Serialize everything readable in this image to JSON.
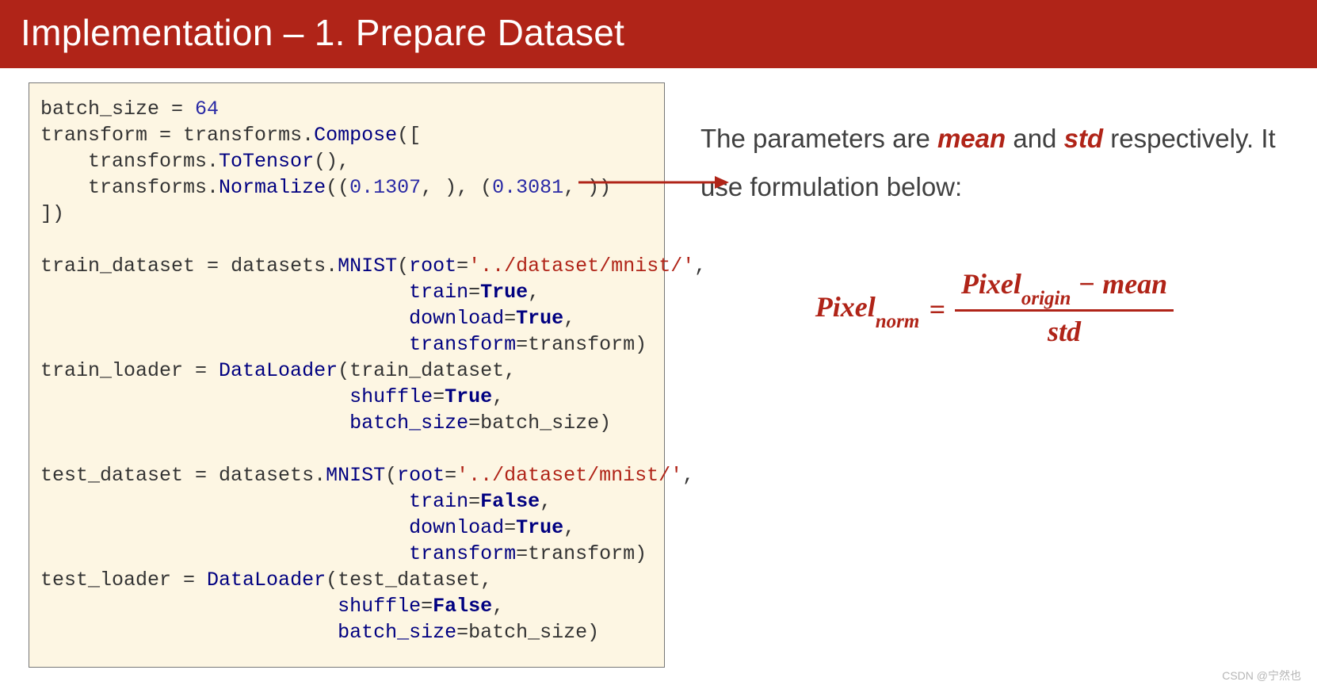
{
  "header": {
    "title": "Implementation – 1. Prepare Dataset"
  },
  "code": {
    "batch_var": "batch_size",
    "eq": " = ",
    "batch_val": "64",
    "transform_var": "transform",
    "compose": "transforms.",
    "compose_fn": "Compose",
    "open_br": "([",
    "indent": "    ",
    "totensor": "transforms.",
    "totensor_fn": "ToTensor",
    "totensor_tail": "(),",
    "normalize": "transforms.",
    "normalize_fn": "Normalize",
    "norm_open": "((",
    "mean_val": "0.1307",
    "norm_mid": ", ), (",
    "std_val": "0.3081",
    "norm_close": ", ))",
    "close_br": "])",
    "train_ds_var": "train_dataset",
    "datasets": "datasets.",
    "mnist_fn": "MNIST",
    "paren_open": "(",
    "root_kw": "root",
    "root_eq": "=",
    "root_val": "'../dataset/mnist/'",
    "comma": ",",
    "cont_indent": "                               ",
    "dl_indent": "                          ",
    "dl2_indent": "                         ",
    "train_kw": "train",
    "true": "True",
    "false": "False",
    "download_kw": "download",
    "transform_kw": "transform",
    "transform_val": "=transform)",
    "train_ld_var": "train_loader",
    "dataloader_fn": "DataLoader",
    "train_ds_arg": "(train_dataset,",
    "shuffle_kw": "shuffle",
    "batch_kw": "batch_size",
    "batch_val2": "=batch_size)",
    "test_ds_var": "test_dataset",
    "test_ld_var": "test_loader",
    "test_ds_arg": "(test_dataset,"
  },
  "desc": {
    "t1": "The parameters are ",
    "mean": "mean",
    "t2": " and ",
    "std": "std",
    "t3": " respectively. It use formulation below:"
  },
  "formula": {
    "lhs_main": "Pixel",
    "lhs_sub": "norm",
    "equals": "=",
    "num_main": "Pixel",
    "num_sub": "origin",
    "minus": " − ",
    "num_tail": "mean",
    "den": "std"
  },
  "watermark": "CSDN @宁然也"
}
